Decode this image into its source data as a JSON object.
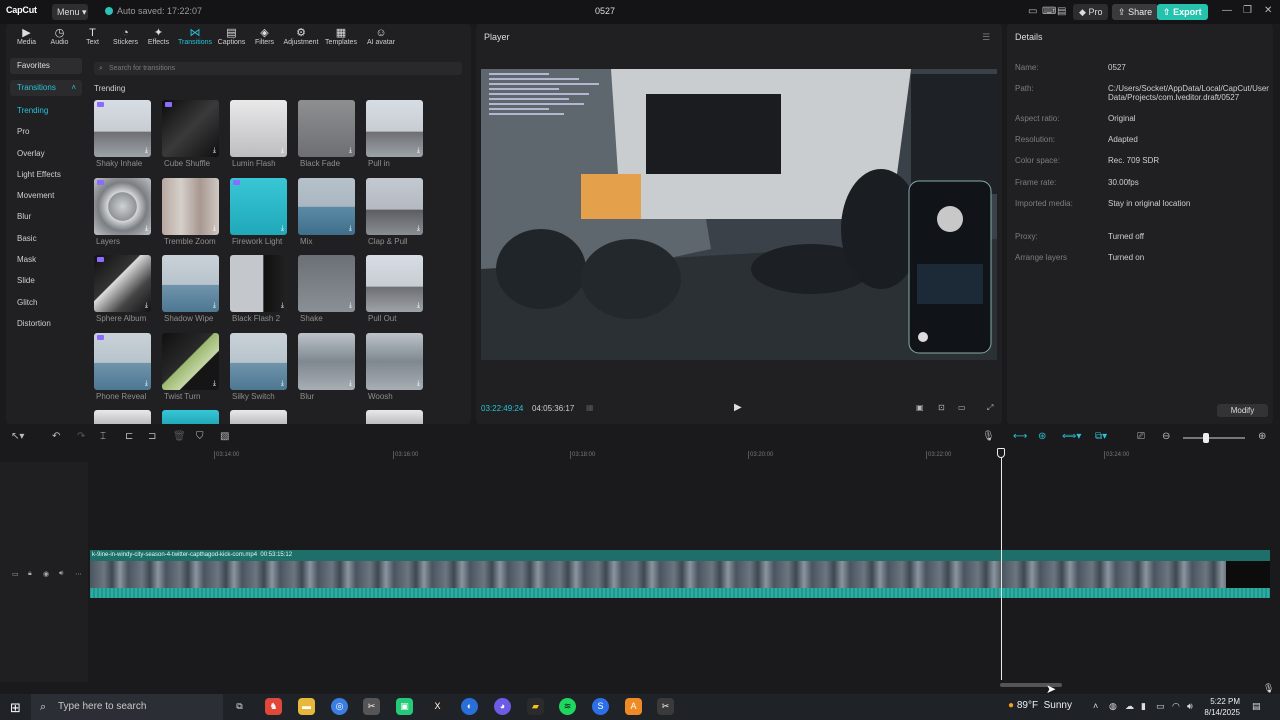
{
  "app": {
    "logo": "CapCut",
    "menu": "Menu",
    "autosave": "Auto saved: 17:22:07",
    "project_title": "0527"
  },
  "titlebar": {
    "pro": "Pro",
    "share": "Share",
    "export": "Export"
  },
  "tools": [
    {
      "label": "Media",
      "icon": "media-icon"
    },
    {
      "label": "Audio",
      "icon": "audio-icon"
    },
    {
      "label": "Text",
      "icon": "text-icon"
    },
    {
      "label": "Stickers",
      "icon": "sticker-icon"
    },
    {
      "label": "Effects",
      "icon": "effects-icon"
    },
    {
      "label": "Transitions",
      "icon": "transitions-icon",
      "active": true
    },
    {
      "label": "Captions",
      "icon": "captions-icon"
    },
    {
      "label": "Filters",
      "icon": "filters-icon"
    },
    {
      "label": "Adjustment",
      "icon": "adjustment-icon"
    },
    {
      "label": "Templates",
      "icon": "templates-icon"
    },
    {
      "label": "AI avatar",
      "icon": "ai-avatar-icon"
    }
  ],
  "sidebar": {
    "favorites": "Favorites",
    "transitions": "Transitions",
    "items": [
      "Trending",
      "Pro",
      "Overlay",
      "Light Effects",
      "Movement",
      "Blur",
      "Basic",
      "Mask",
      "Slide",
      "Glitch",
      "Distortion"
    ]
  },
  "search": {
    "placeholder": "Search for transitions"
  },
  "trending_label": "Trending",
  "transitions": [
    "Shaky Inhale",
    "Cube Shuffle",
    "Lumin Flash",
    "Black Fade",
    "Pull in",
    "Layers",
    "Tremble Zoom",
    "Firework Light",
    "Mix",
    "Clap & Pull",
    "Sphere Album",
    "Shadow Wipe",
    "Black Flash 2",
    "Shake",
    "Pull Out",
    "Phone Reveal",
    "Twist Turn",
    "Silky Switch",
    "Blur",
    "Woosh"
  ],
  "player": {
    "title": "Player",
    "current_time": "03:22:49:24",
    "total_time": "04:05:36:17"
  },
  "details": {
    "title": "Details",
    "rows": [
      {
        "key": "Name:",
        "value": "0527"
      },
      {
        "key": "Path:",
        "value": "C:/Users/Socket/AppData/Local/CapCut/User Data/Projects/com.lveditor.draft/0527"
      },
      {
        "key": "Aspect ratio:",
        "value": "Original"
      },
      {
        "key": "Resolution:",
        "value": "Adapted"
      },
      {
        "key": "Color space:",
        "value": "Rec. 709 SDR"
      },
      {
        "key": "Frame rate:",
        "value": "30.00fps"
      },
      {
        "key": "Imported media:",
        "value": "Stay in original location"
      },
      {
        "key": "Proxy:",
        "value": "Turned off"
      },
      {
        "key": "Arrange layers",
        "value": "Turned on"
      }
    ],
    "modify": "Modify"
  },
  "timeline": {
    "ticks": [
      "03:14:00",
      "03:16:00",
      "03:18:00",
      "03:20:00",
      "03:22:00",
      "03:24:00"
    ],
    "clip_name": "k-9ine-in-windy-city-season-4-twitter-capthagod-kick-com.mp4",
    "clip_duration": "00:53:15:12"
  },
  "taskbar": {
    "search_placeholder": "Type here to search",
    "weather_temp": "89°F",
    "weather_desc": "Sunny",
    "time": "5:22 PM",
    "date": "8/14/2025"
  }
}
